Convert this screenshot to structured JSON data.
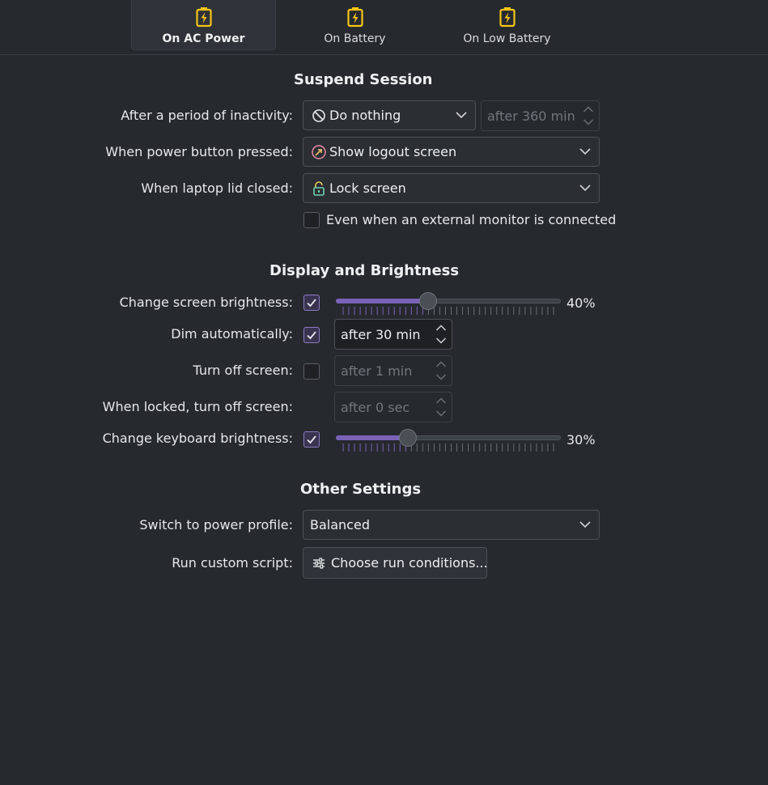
{
  "tabs": [
    {
      "label": "On AC Power",
      "active": true,
      "icon": "battery-charging-icon"
    },
    {
      "label": "On Battery",
      "active": false,
      "icon": "battery-charging-icon"
    },
    {
      "label": "On Low Battery",
      "active": false,
      "icon": "battery-charging-icon"
    }
  ],
  "suspend": {
    "title": "Suspend Session",
    "inactivity_label": "After a period of inactivity:",
    "inactivity_value": "Do nothing",
    "inactivity_time": "after 360 min",
    "power_button_label": "When power button pressed:",
    "power_button_value": "Show logout screen",
    "lid_label": "When laptop lid closed:",
    "lid_value": "Lock screen",
    "external_monitor_label": "Even when an external monitor is connected",
    "external_monitor_checked": false
  },
  "display": {
    "title": "Display and Brightness",
    "screen_brightness_label": "Change screen brightness:",
    "screen_brightness_checked": true,
    "screen_brightness_value": "40%",
    "screen_brightness_level": 0.4,
    "dim_label": "Dim automatically:",
    "dim_checked": true,
    "dim_value": "after 30 min",
    "turn_off_label": "Turn off screen:",
    "turn_off_checked": false,
    "turn_off_value": "after 1 min",
    "locked_label": "When locked, turn off screen:",
    "locked_value": "after 0 sec",
    "keyboard_brightness_label": "Change keyboard brightness:",
    "keyboard_brightness_checked": true,
    "keyboard_brightness_value": "30%",
    "keyboard_brightness_level": 0.3
  },
  "other": {
    "title": "Other Settings",
    "profile_label": "Switch to power profile:",
    "profile_value": "Balanced",
    "script_label": "Run custom script:",
    "script_button": "Choose run conditions..."
  },
  "colors": {
    "accent": "#7a62b8",
    "battery_icon": "#f5c518",
    "background": "#26292e"
  }
}
